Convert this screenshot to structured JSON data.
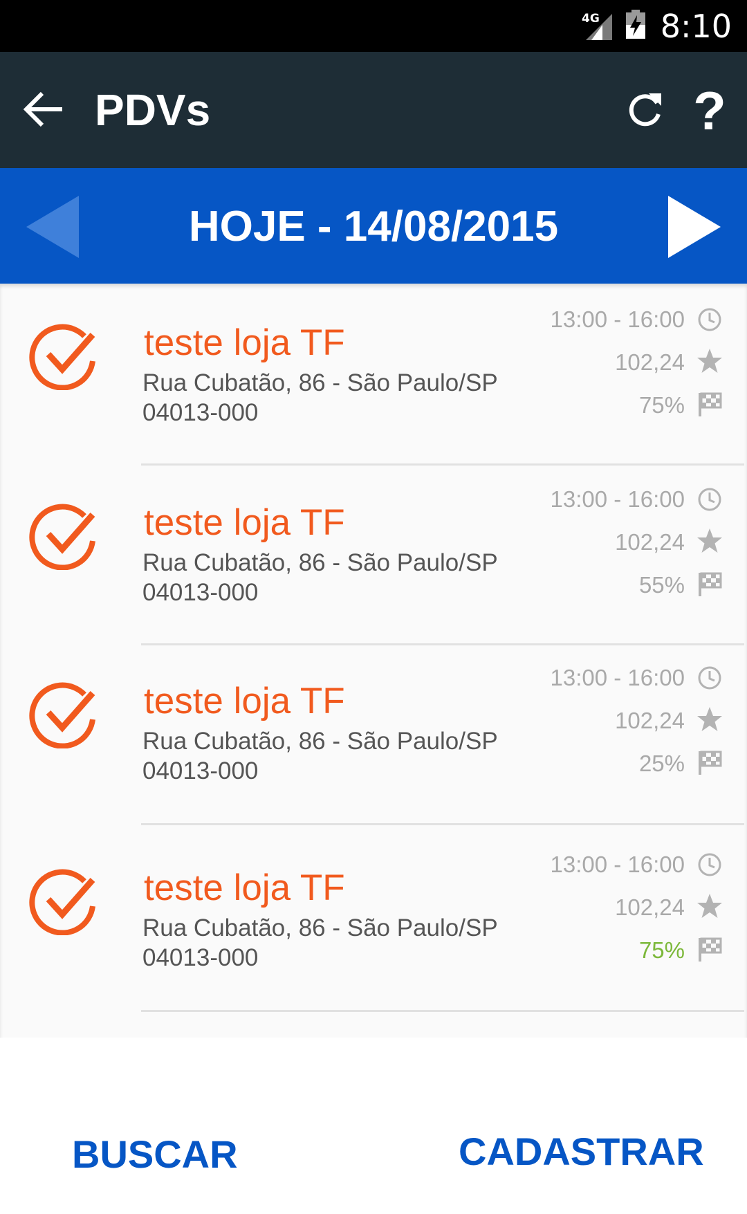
{
  "status": {
    "network": "4G",
    "time": "8:10"
  },
  "app_bar": {
    "title": "PDVs",
    "help_label": "?"
  },
  "date_nav": {
    "label": "HOJE - 14/08/2015"
  },
  "pdvs": [
    {
      "name": "teste loja TF",
      "address": "Rua Cubatão, 86 - São Paulo/SP",
      "zip": "04013-000",
      "time": "13:00 - 16:00",
      "score": "102,24",
      "progress": "75%"
    },
    {
      "name": "teste loja TF",
      "address": "Rua Cubatão, 86 - São Paulo/SP",
      "zip": "04013-000",
      "time": "13:00 - 16:00",
      "score": "102,24",
      "progress": "55%"
    },
    {
      "name": "teste loja TF",
      "address": "Rua Cubatão, 86 - São Paulo/SP",
      "zip": "04013-000",
      "time": "13:00 - 16:00",
      "score": "102,24",
      "progress": "25%"
    },
    {
      "name": "teste loja TF",
      "address": "Rua Cubatão, 86 - São Paulo/SP",
      "zip": "04013-000",
      "time": "13:00 - 16:00",
      "score": "102,24",
      "progress": "75%"
    }
  ],
  "actions": {
    "search_label": "BUSCAR",
    "register_label": "CADASTRAR"
  },
  "colors": {
    "accent_orange": "#f15a1e",
    "primary_blue": "#0656c5",
    "toolbar": "#1e2d36",
    "progress_highlight": "#7cb83a"
  }
}
